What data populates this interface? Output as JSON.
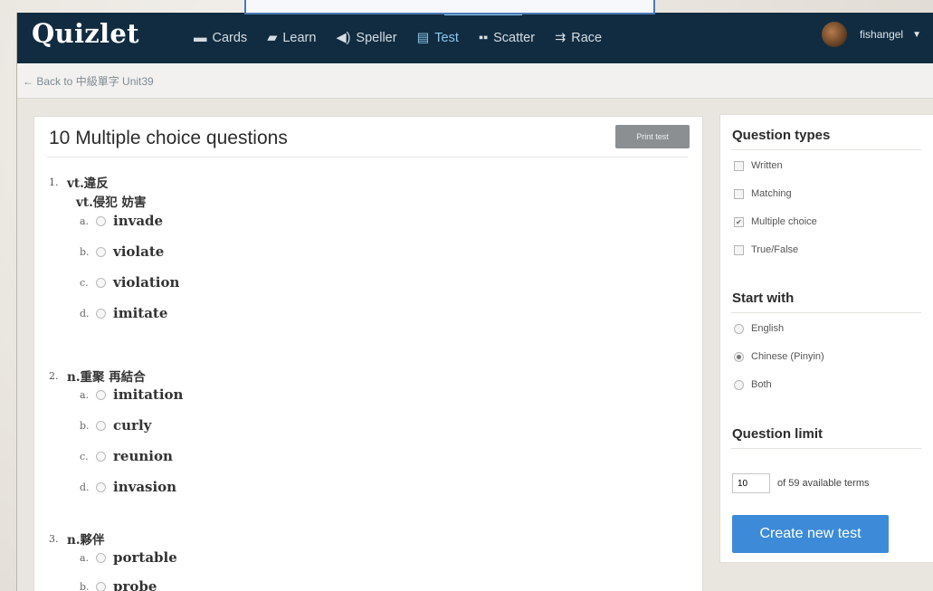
{
  "app": {
    "logo": "Quizlet"
  },
  "nav": [
    {
      "label": "Cards",
      "icon": "cards-icon",
      "glyph": "▬",
      "active": false
    },
    {
      "label": "Learn",
      "icon": "learn-icon",
      "glyph": "▰",
      "active": false
    },
    {
      "label": "Speller",
      "icon": "speaker-icon",
      "glyph": "◀)",
      "active": false
    },
    {
      "label": "Test",
      "icon": "test-document-icon",
      "glyph": "▤",
      "active": true
    },
    {
      "label": "Scatter",
      "icon": "scatter-icon",
      "glyph": "▪▪",
      "active": false
    },
    {
      "label": "Race",
      "icon": "race-icon",
      "glyph": "⇉",
      "active": false
    }
  ],
  "user": {
    "name": "fishangel",
    "caret": "▼"
  },
  "subnav": {
    "back": "← Back to 中級單字 Unit39"
  },
  "test": {
    "title": "10 Multiple choice questions",
    "print_label": "Print test",
    "questions": [
      {
        "num": "1.",
        "lines": [
          "vt.違反",
          "vt.侵犯 妨害"
        ],
        "options": [
          {
            "letter": "a.",
            "word": "invade"
          },
          {
            "letter": "b.",
            "word": "violate"
          },
          {
            "letter": "c.",
            "word": "violation"
          },
          {
            "letter": "d.",
            "word": "imitate"
          }
        ]
      },
      {
        "num": "2.",
        "lines": [
          "n.重聚 再結合"
        ],
        "options": [
          {
            "letter": "a.",
            "word": "imitation"
          },
          {
            "letter": "b.",
            "word": "curly"
          },
          {
            "letter": "c.",
            "word": "reunion"
          },
          {
            "letter": "d.",
            "word": "invasion"
          }
        ]
      },
      {
        "num": "3.",
        "lines": [
          "n.夥伴"
        ],
        "options": [
          {
            "letter": "a.",
            "word": "portable"
          },
          {
            "letter": "b.",
            "word": "probe"
          }
        ]
      }
    ]
  },
  "sidebar": {
    "question_types": {
      "heading": "Question types",
      "items": [
        {
          "label": "Written",
          "checked": false
        },
        {
          "label": "Matching",
          "checked": false
        },
        {
          "label": "Multiple choice",
          "checked": true
        },
        {
          "label": "True/False",
          "checked": false
        }
      ]
    },
    "start_with": {
      "heading": "Start with",
      "items": [
        {
          "label": "English",
          "selected": false
        },
        {
          "label": "Chinese (Pinyin)",
          "selected": true
        },
        {
          "label": "Both",
          "selected": false
        }
      ]
    },
    "question_limit": {
      "heading": "Question limit",
      "value": "10",
      "suffix": "of 59 available terms"
    },
    "create_label": "Create new test"
  }
}
